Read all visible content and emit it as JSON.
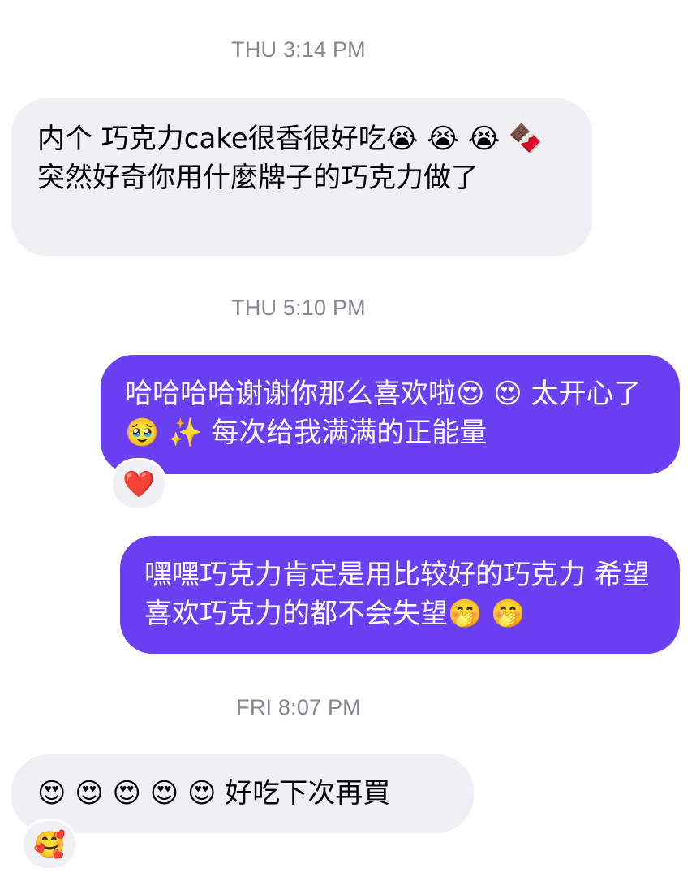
{
  "conversation": {
    "timestamps": [
      "THU 3:14 PM",
      "THU 5:10 PM",
      "FRI 8:07 PM"
    ],
    "messages": [
      {
        "direction": "incoming",
        "text": "内个 巧克力cake很香很好吃😭 😭 😭 🍫突然好奇你用什麼牌子的巧克力做了"
      },
      {
        "direction": "outgoing",
        "text": "哈哈哈哈谢谢你那么喜欢啦😍 😍 太开心了🥹 ✨ 每次给我满满的正能量",
        "reaction": "❤️"
      },
      {
        "direction": "outgoing",
        "text": "嘿嘿巧克力肯定是用比较好的巧克力 希望喜欢巧克力的都不会失望🤭 🤭"
      },
      {
        "direction": "incoming",
        "text": "😍 😍 😍 😍 😍 好吃下次再買",
        "reaction": "🥰"
      }
    ]
  },
  "colors": {
    "incoming_bubble": "#efeff4",
    "outgoing_bubble": "#6b3ff2",
    "timestamp_text": "#86868c"
  }
}
